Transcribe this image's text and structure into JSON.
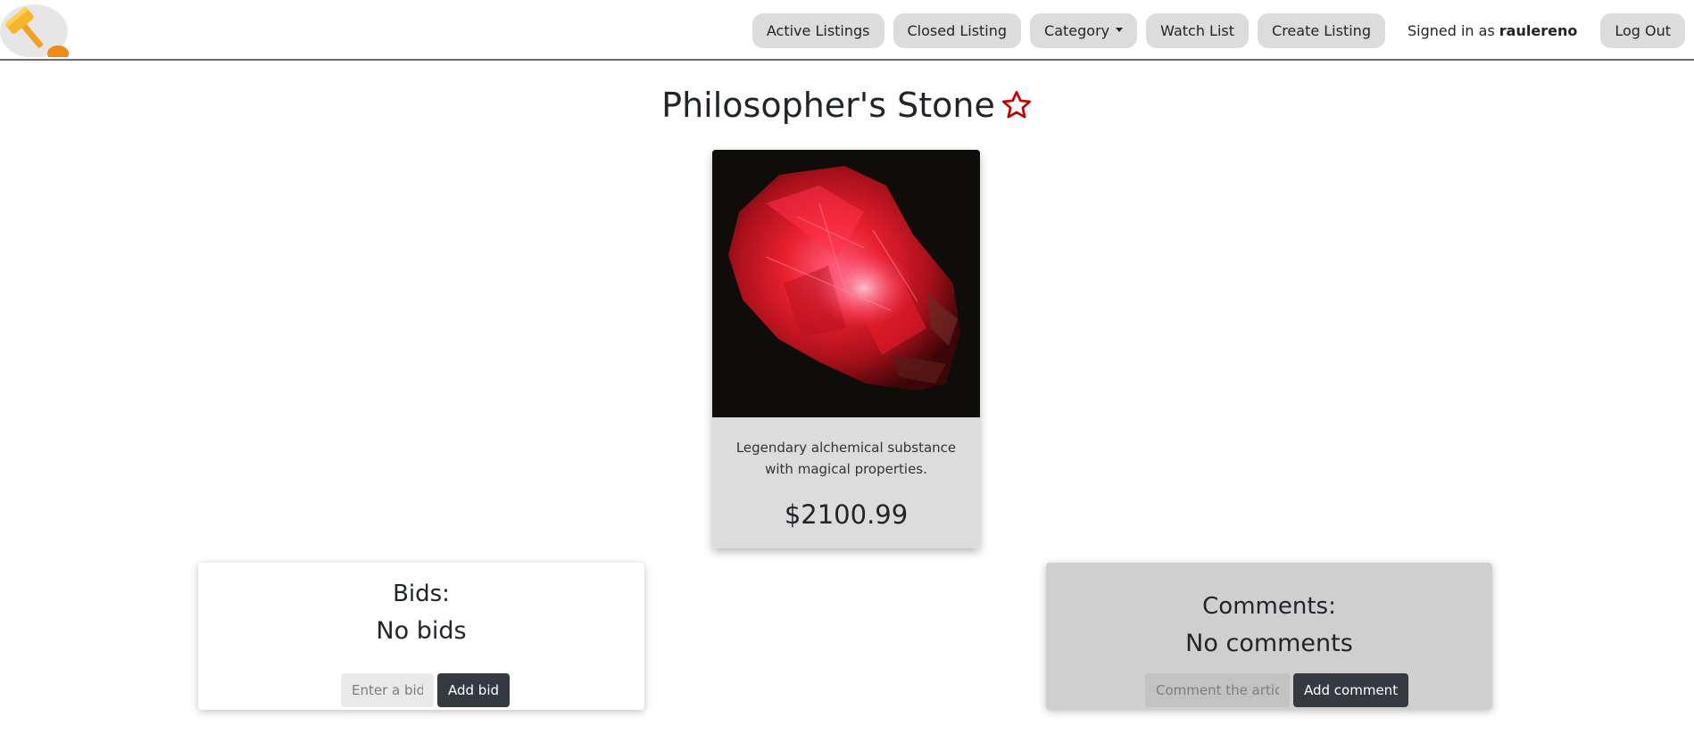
{
  "nav": {
    "logo_icon": "gavel-icon",
    "buttons": [
      {
        "label": "Active Listings"
      },
      {
        "label": "Closed Listing"
      },
      {
        "label": "Category"
      },
      {
        "label": "Watch List"
      },
      {
        "label": "Create Listing"
      }
    ],
    "signed_prefix": "Signed in as",
    "username": "raulereno",
    "logout_label": "Log Out"
  },
  "listing": {
    "title": "Philosopher's Stone",
    "watch_icon": "star-outline-icon",
    "star_color": "#c00000",
    "image_icon": "red-gemstone-image",
    "description": "Legendary alchemical substance with magical properties.",
    "price": "$2100.99"
  },
  "bids": {
    "heading": "Bids:",
    "status": "No bids",
    "input_placeholder": "Enter a bid",
    "button_label": "Add bid"
  },
  "comments": {
    "heading": "Comments:",
    "status": "No comments",
    "input_placeholder": "Comment the article",
    "button_label": "Add comment"
  },
  "colors": {
    "dark_button": "#343a40",
    "nav_button_bg": "#dcdcdc",
    "card_bg": "#dcdcdc"
  }
}
